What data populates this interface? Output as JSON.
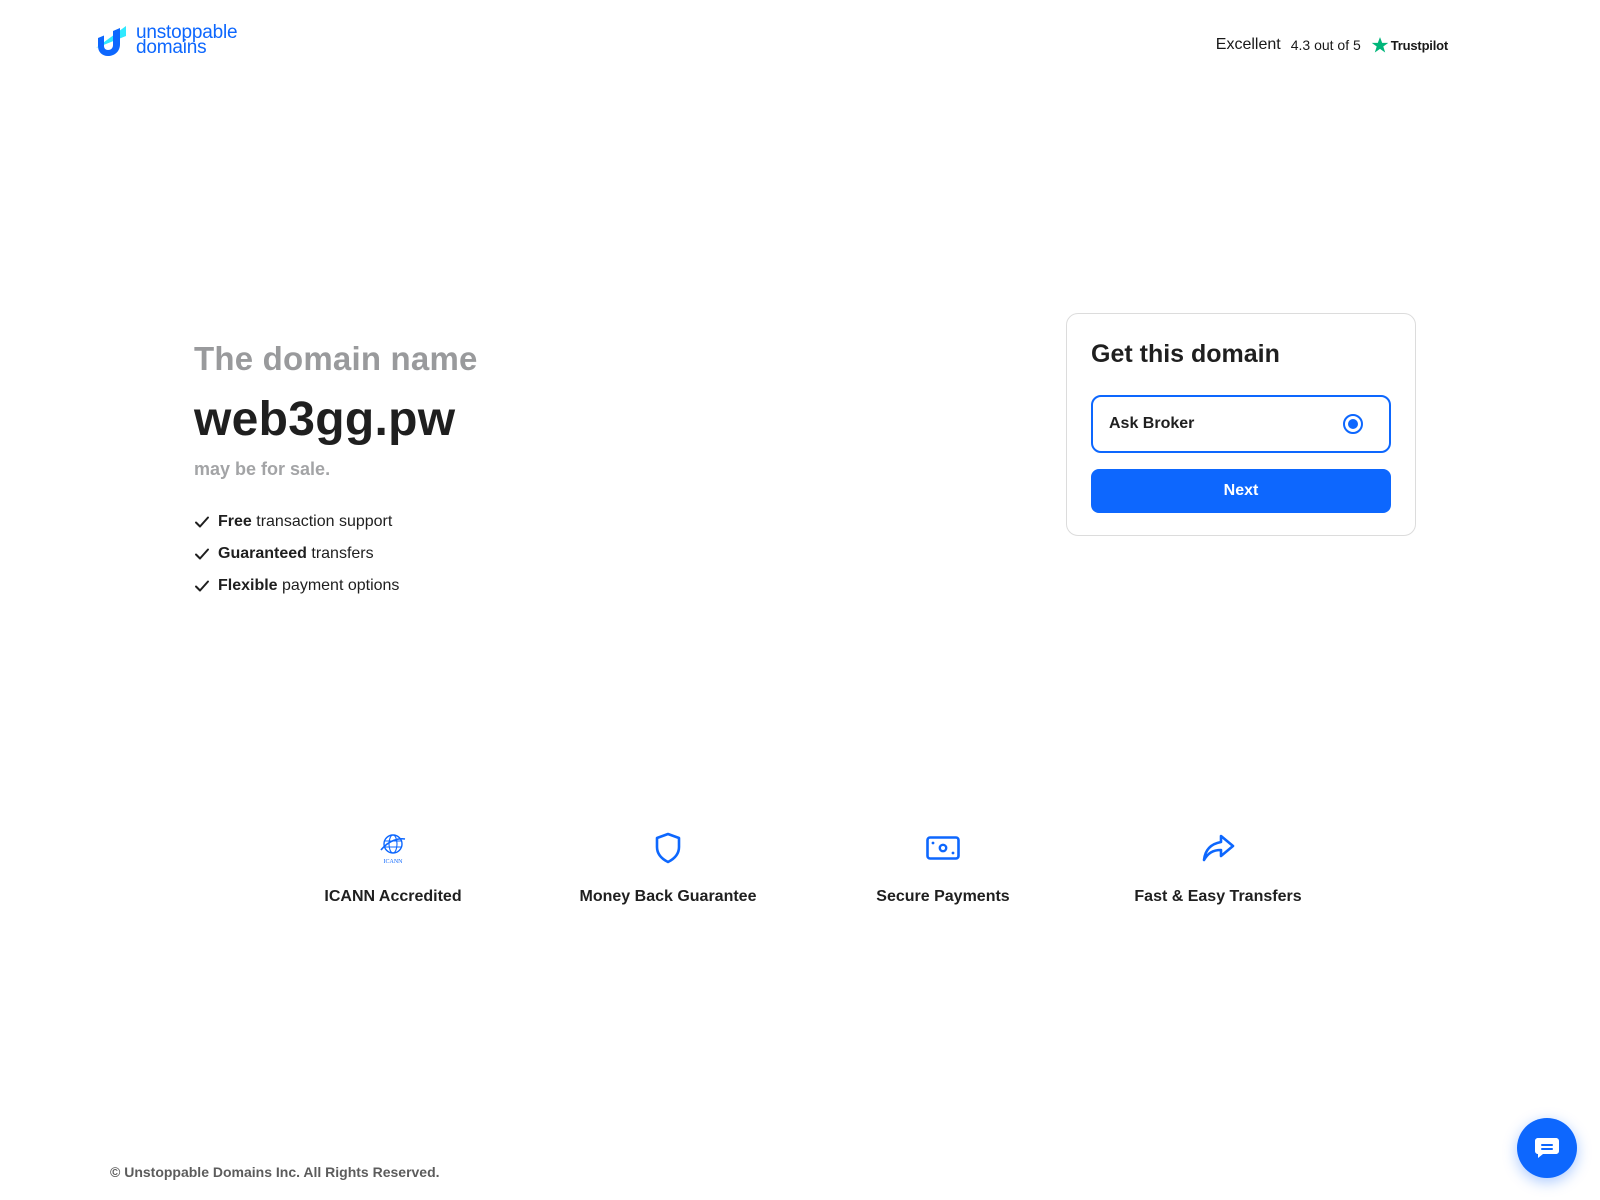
{
  "header": {
    "logo_line1": "unstoppable",
    "logo_line2": "domains",
    "trustpilot": {
      "rating_word": "Excellent",
      "score": "4.3 out of 5",
      "brand": "Trustpilot"
    }
  },
  "hero": {
    "eyebrow": "The domain name",
    "domain": "web3gg.pw",
    "subtitle": "may be for sale.",
    "features": [
      {
        "bold": "Free",
        "rest": " transaction support"
      },
      {
        "bold": "Guaranteed",
        "rest": " transfers"
      },
      {
        "bold": "Flexible",
        "rest": " payment options"
      }
    ]
  },
  "card": {
    "title": "Get this domain",
    "option_label": "Ask Broker",
    "option_selected": true,
    "button_label": "Next"
  },
  "benefits": [
    {
      "title": "ICANN Accredited",
      "icon": "icann-logo-icon",
      "icon_caption": "ICANN"
    },
    {
      "title": "Money Back Guarantee",
      "icon": "shield-icon"
    },
    {
      "title": "Secure Payments",
      "icon": "cash-icon"
    },
    {
      "title": "Fast & Easy Transfers",
      "icon": "share-arrow-icon"
    }
  ],
  "footer": {
    "copyright": "© Unstoppable Domains Inc. All Rights Reserved."
  },
  "chat": {
    "icon": "chat-bubble-icon"
  },
  "colors": {
    "brand_blue": "#0d67fe",
    "trustpilot_green": "#00b67a",
    "muted_gray": "#999a9c"
  }
}
